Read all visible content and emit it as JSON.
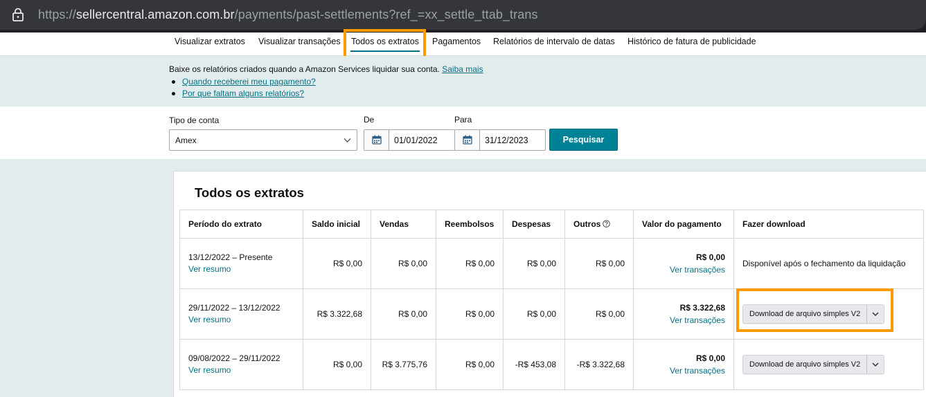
{
  "browser": {
    "url_scheme": "https://",
    "url_host": "sellercentral.amazon.com.br",
    "url_path": "/payments/past-settlements?ref_=xx_settle_ttab_trans"
  },
  "tabs": [
    {
      "label": "Visualizar extratos"
    },
    {
      "label": "Visualizar transações"
    },
    {
      "label": "Todos os extratos",
      "active": true
    },
    {
      "label": "Pagamentos"
    },
    {
      "label": "Relatórios de intervalo de datas"
    },
    {
      "label": "Histórico de fatura de publicidade"
    }
  ],
  "info": {
    "text": "Baixe os relatórios criados quando a Amazon Services liquidar sua conta.",
    "learn_more": "Saiba mais",
    "links": [
      "Quando receberei meu pagamento?",
      "Por que faltam alguns relatórios?"
    ]
  },
  "filters": {
    "account_label": "Tipo de conta",
    "account_value": "Amex",
    "from_label": "De",
    "from_value": "01/01/2022",
    "to_label": "Para",
    "to_value": "31/12/2023",
    "search_button": "Pesquisar"
  },
  "panel": {
    "title": "Todos os extratos",
    "columns": [
      "Período do extrato",
      "Saldo inicial",
      "Vendas",
      "Reembolsos",
      "Despesas",
      "Outros",
      "Valor do pagamento",
      "Fazer download"
    ],
    "rows": [
      {
        "period": "13/12/2022 – Presente",
        "summary_link": "Ver resumo",
        "opening": "R$ 0,00",
        "sales": "R$ 0,00",
        "refunds": "R$ 0,00",
        "expenses": "R$ 0,00",
        "other": "R$ 0,00",
        "payment": "R$ 0,00",
        "transactions_link": "Ver transações",
        "download_text": "Disponível após o fechamento da liquidação"
      },
      {
        "period": "29/11/2022 – 13/12/2022",
        "summary_link": "Ver resumo",
        "opening": "R$ 3.322,68",
        "sales": "R$ 0,00",
        "refunds": "R$ 0,00",
        "expenses": "R$ 0,00",
        "other": "R$ 0,00",
        "payment": "R$ 3.322,68",
        "transactions_link": "Ver transações",
        "download_button": "Download de arquivo simples V2"
      },
      {
        "period": "09/08/2022 – 29/11/2022",
        "summary_link": "Ver resumo",
        "opening": "R$ 0,00",
        "sales": "R$ 3.775,76",
        "refunds": "R$ 0,00",
        "expenses": "-R$ 453,08",
        "other": "-R$ 3.322,68",
        "payment": "R$ 0,00",
        "transactions_link": "Ver transações",
        "download_button": "Download de arquivo simples V2"
      }
    ]
  },
  "colors": {
    "accent": "#007185",
    "button": "#008296",
    "highlight": "#ff9900"
  }
}
